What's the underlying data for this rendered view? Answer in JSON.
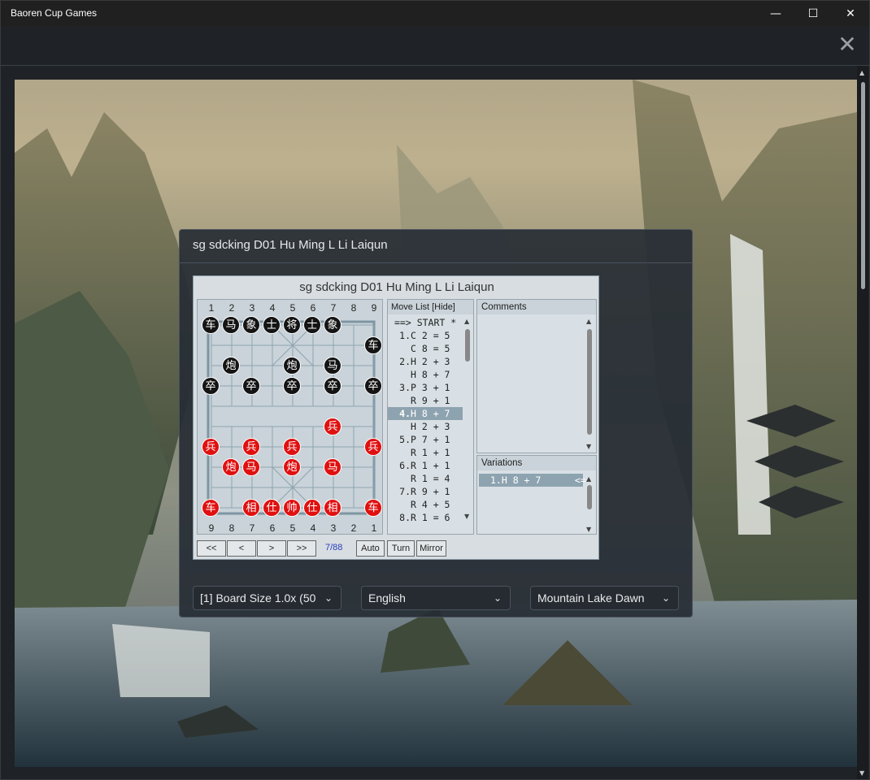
{
  "window": {
    "title": "Baoren Cup Games",
    "minimize": "—",
    "maximize": "☐",
    "close": "✕",
    "panel_close": "✕"
  },
  "panel": {
    "title": "sg sdcking D01 Hu Ming L Li Laiqun"
  },
  "viewer": {
    "title": "sg sdcking D01 Hu Ming L Li Laiqun",
    "top_coords": [
      "1",
      "2",
      "3",
      "4",
      "5",
      "6",
      "7",
      "8",
      "9"
    ],
    "bottom_coords": [
      "9",
      "8",
      "7",
      "6",
      "5",
      "4",
      "3",
      "2",
      "1"
    ],
    "black_pieces": [
      {
        "ch": "车"
      },
      {
        "ch": "马"
      },
      {
        "ch": "象"
      },
      {
        "ch": "士"
      },
      {
        "ch": "将"
      },
      {
        "ch": "士"
      },
      {
        "ch": "象"
      },
      {
        "ch": "车"
      },
      {
        "ch": "炮"
      },
      {
        "ch": "炮"
      },
      {
        "ch": "马"
      },
      {
        "ch": "卒"
      },
      {
        "ch": "卒"
      },
      {
        "ch": "卒"
      },
      {
        "ch": "卒"
      },
      {
        "ch": "卒"
      }
    ],
    "red_pieces": [
      {
        "ch": "兵"
      },
      {
        "ch": "兵"
      },
      {
        "ch": "兵"
      },
      {
        "ch": "兵"
      },
      {
        "ch": "兵"
      },
      {
        "ch": "炮"
      },
      {
        "ch": "马"
      },
      {
        "ch": "炮"
      },
      {
        "ch": "马"
      },
      {
        "ch": "车"
      },
      {
        "ch": "相"
      },
      {
        "ch": "仕"
      },
      {
        "ch": "帅"
      },
      {
        "ch": "仕"
      },
      {
        "ch": "相"
      },
      {
        "ch": "车"
      }
    ],
    "move_list_header": "Move List [Hide]",
    "moves": [
      {
        "num": "",
        "text": "==> START *",
        "selected": false
      },
      {
        "num": "1.",
        "text": "C 2 = 5",
        "selected": false
      },
      {
        "num": "",
        "text": "C 8 = 5",
        "selected": false
      },
      {
        "num": "2.",
        "text": "H 2 + 3",
        "selected": false
      },
      {
        "num": "",
        "text": "H 8 + 7",
        "selected": false
      },
      {
        "num": "3.",
        "text": "P 3 + 1",
        "selected": false
      },
      {
        "num": "",
        "text": "R 9 + 1",
        "selected": false
      },
      {
        "num": "4.",
        "text": "H 8 + 7",
        "selected": true
      },
      {
        "num": "",
        "text": "H 2 + 3",
        "selected": false
      },
      {
        "num": "5.",
        "text": "P 7 + 1",
        "selected": false
      },
      {
        "num": "",
        "text": "R 1 + 1",
        "selected": false
      },
      {
        "num": "6.",
        "text": "R 1 + 1",
        "selected": false
      },
      {
        "num": "",
        "text": "R 1 = 4",
        "selected": false
      },
      {
        "num": "7.",
        "text": "R 9 + 1",
        "selected": false
      },
      {
        "num": "",
        "text": "R 4 + 5",
        "selected": false
      },
      {
        "num": "8.",
        "text": "R 1 = 6",
        "selected": false
      }
    ],
    "comments_header": "Comments",
    "variations_header": "Variations",
    "variation_item": "1.H 8 + 7      <=",
    "nav": {
      "first": "<<",
      "prev": "<",
      "next": ">",
      "last": ">>",
      "counter": "7/88",
      "auto": "Auto",
      "turn": "Turn",
      "mirror": "Mirror"
    }
  },
  "controls": {
    "board_size": "[1] Board Size 1.0x (50",
    "language": "English",
    "theme": "Mountain Lake Dawn",
    "chevron": "⌄"
  },
  "colors": {
    "black_piece": "#141414",
    "red_piece": "#e01010",
    "selected_move": "#8ea3b0"
  }
}
